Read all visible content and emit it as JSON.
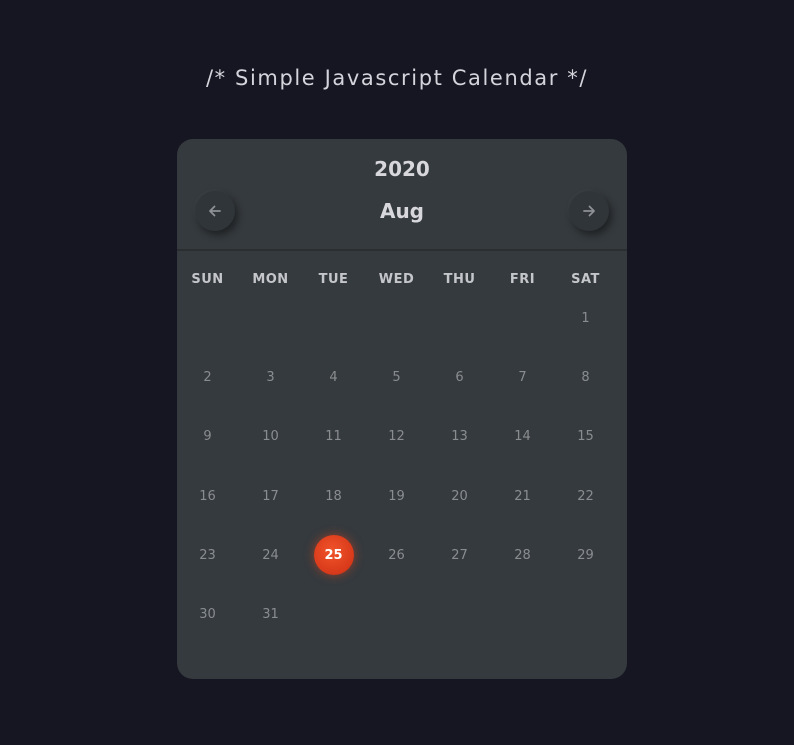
{
  "page": {
    "heading": "/* Simple Javascript Calendar */"
  },
  "calendar": {
    "year": "2020",
    "month": "Aug",
    "prev_icon": "arrow-left-icon",
    "next_icon": "arrow-right-icon",
    "weekdays": [
      "SUN",
      "MON",
      "TUE",
      "WED",
      "THU",
      "FRI",
      "SAT"
    ],
    "first_weekday_index": 6,
    "days_in_month": 31,
    "today": "25",
    "days": [
      "1",
      "2",
      "3",
      "4",
      "5",
      "6",
      "7",
      "8",
      "9",
      "10",
      "11",
      "12",
      "13",
      "14",
      "15",
      "16",
      "17",
      "18",
      "19",
      "20",
      "21",
      "22",
      "23",
      "24",
      "25",
      "26",
      "27",
      "28",
      "29",
      "30",
      "31"
    ],
    "colors": {
      "background": "#161622",
      "card": "#353a3e",
      "accent": "#e4461f",
      "day_text": "#8a8d90"
    }
  }
}
